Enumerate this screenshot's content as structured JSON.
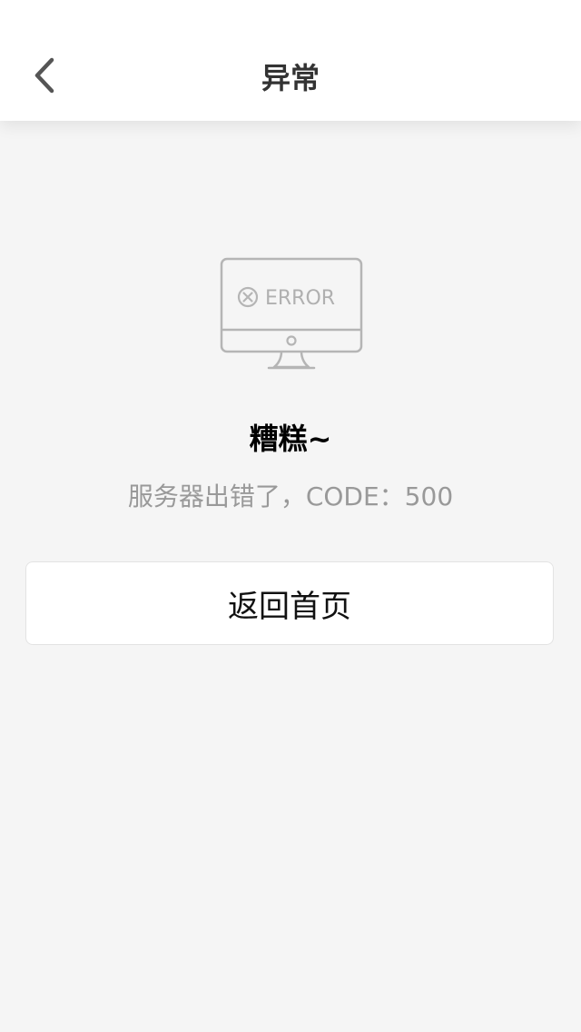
{
  "header": {
    "title": "异常",
    "back_icon": "chevron-left-icon"
  },
  "illustration": {
    "icon": "monitor-error-icon",
    "screen_text": "ERROR",
    "color": "#b0b0b0"
  },
  "message": {
    "headline": "糟糕~",
    "detail": "服务器出错了，CODE：500"
  },
  "actions": {
    "home_label": "返回首页"
  },
  "colors": {
    "background": "#f5f5f5",
    "header_bg": "#ffffff",
    "title": "#333333",
    "muted": "#999999"
  }
}
